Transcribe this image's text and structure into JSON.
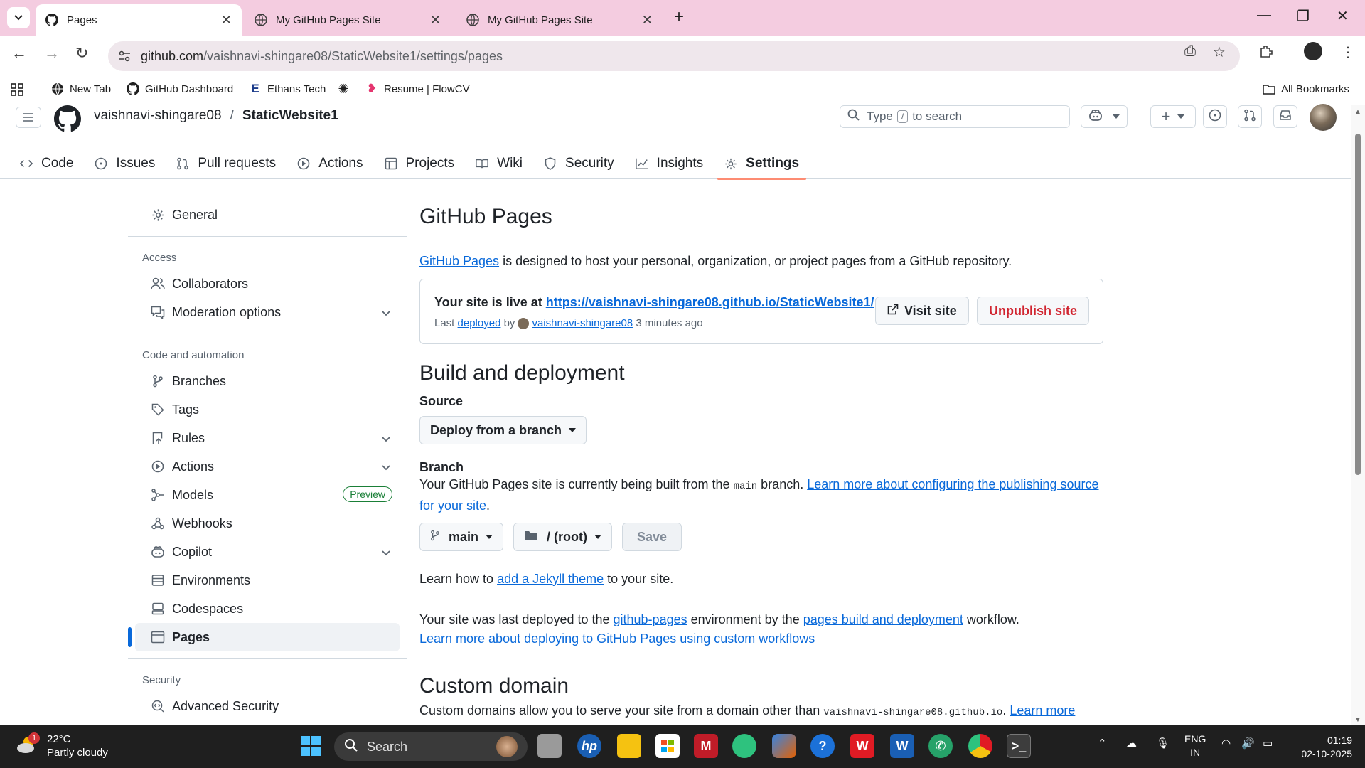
{
  "browser": {
    "tabs": [
      {
        "title": "Pages",
        "active": true
      },
      {
        "title": "My GitHub Pages Site",
        "active": false
      },
      {
        "title": "My GitHub Pages Site",
        "active": false
      }
    ],
    "url_host": "github.com",
    "url_path": "/vaishnavi-shingare08/StaticWebsite1/settings/pages",
    "bookmarks": [
      "New Tab",
      "GitHub Dashboard",
      "Ethans Tech",
      "Resume | FlowCV"
    ],
    "all_bookmarks": "All Bookmarks"
  },
  "header": {
    "owner": "vaishnavi-shingare08",
    "separator": "/",
    "repo": "StaticWebsite1",
    "search_prefix": "Type",
    "search_key": "/",
    "search_suffix": "to search"
  },
  "repo_nav": {
    "code": "Code",
    "issues": "Issues",
    "pull_requests": "Pull requests",
    "actions": "Actions",
    "projects": "Projects",
    "wiki": "Wiki",
    "security": "Security",
    "insights": "Insights",
    "settings": "Settings"
  },
  "sidebar": {
    "general": "General",
    "access_heading": "Access",
    "collaborators": "Collaborators",
    "moderation": "Moderation options",
    "code_heading": "Code and automation",
    "branches": "Branches",
    "tags": "Tags",
    "rules": "Rules",
    "actions": "Actions",
    "models": "Models",
    "models_badge": "Preview",
    "webhooks": "Webhooks",
    "copilot": "Copilot",
    "environments": "Environments",
    "codespaces": "Codespaces",
    "pages": "Pages",
    "security_heading": "Security",
    "advanced_security": "Advanced Security"
  },
  "main": {
    "title": "GitHub Pages",
    "intro_link": "GitHub Pages",
    "intro_rest": " is designed to host your personal, organization, or project pages from a GitHub repository.",
    "live_prefix": "Your site is live at ",
    "live_url": "https://vaishnavi-shingare08.github.io/StaticWebsite1/",
    "last_label": "Last",
    "deployed_link": "deployed",
    "by_label": "by",
    "deployer": "vaishnavi-shingare08",
    "time_ago": "3 minutes ago",
    "visit_site": "Visit site",
    "unpublish_site": "Unpublish site",
    "build_title": "Build and deployment",
    "source_label": "Source",
    "source_value": "Deploy from a branch",
    "branch_label": "Branch",
    "branch_text_1": "Your GitHub Pages site is currently being built from the ",
    "branch_code": "main",
    "branch_text_2": " branch. ",
    "branch_link": "Learn more about configuring the publishing source for your site",
    "branch_text_3": ".",
    "branch_select": "main",
    "folder_select": "/ (root)",
    "save": "Save",
    "jekyll_1": "Learn how to ",
    "jekyll_link": "add a Jekyll theme",
    "jekyll_2": " to your site.",
    "deploy_1": "Your site was last deployed to the ",
    "deploy_env_link": "github-pages",
    "deploy_2": " environment by the ",
    "deploy_workflow_link": "pages build and deployment",
    "deploy_3": " workflow.",
    "deploy_learn_link": "Learn more about deploying to GitHub Pages using custom workflows",
    "custom_domain_title": "Custom domain",
    "custom_1": "Custom domains allow you to serve your site from a domain other than ",
    "custom_code": "vaishnavi-shingare08.github.io",
    "custom_2": ". ",
    "custom_link": "Learn more about"
  },
  "taskbar": {
    "temp": "22°C",
    "weather": "Partly cloudy",
    "weather_badge": "1",
    "search": "Search",
    "lang_1": "ENG",
    "lang_2": "IN",
    "time": "01:19",
    "date": "02-10-2025"
  }
}
